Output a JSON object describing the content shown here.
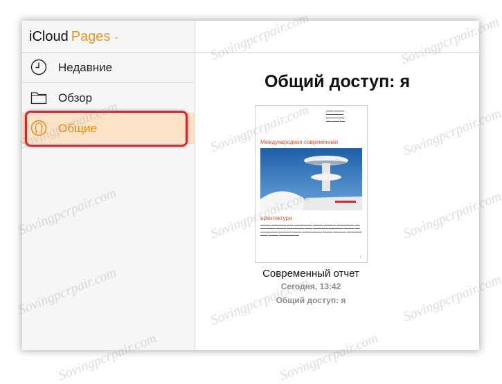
{
  "app": {
    "brand": "iCloud",
    "app_name": "Pages"
  },
  "sidebar": {
    "items": [
      {
        "label": "Недавние",
        "icon": "clock-icon",
        "active": false
      },
      {
        "label": "Обзор",
        "icon": "folder-icon",
        "active": false
      },
      {
        "label": "Общие",
        "icon": "shared-person-icon",
        "active": true
      }
    ]
  },
  "main": {
    "title": "Общий доступ: я",
    "documents": [
      {
        "name": "Современный отчет",
        "modified": "Сегодня, 13:42",
        "shared": "Общий доступ: я",
        "thumbnail": {
          "heading1": "Международная современная",
          "heading2": "архитектура",
          "page_number": "1"
        }
      }
    ]
  },
  "watermark": "Sovingpcrpair.com",
  "colors": {
    "accent": "#f08a10",
    "active_bg": "#fbe3c7",
    "highlight": "#d9262b"
  }
}
